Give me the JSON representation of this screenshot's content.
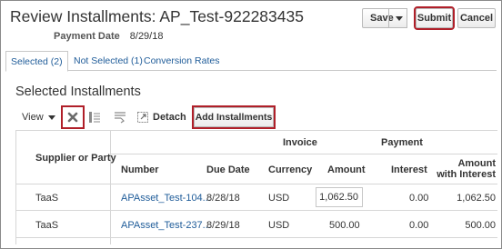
{
  "page": {
    "title": "Review Installments: AP_Test-922283435",
    "payment_date_label": "Payment Date",
    "payment_date_value": "8/29/18"
  },
  "header_buttons": {
    "save": "Save",
    "submit": "Submit",
    "cancel": "Cancel"
  },
  "tabs": [
    {
      "label": "Selected (2)",
      "active": true
    },
    {
      "label": "Not Selected (1)",
      "active": false
    },
    {
      "label": "Conversion Rates",
      "active": false
    }
  ],
  "section_title": "Selected Installments",
  "toolbar": {
    "view_label": "View",
    "detach_label": "Detach",
    "add_installments_label": "Add Installments"
  },
  "table": {
    "group_headers": {
      "invoice": "Invoice",
      "payment": "Payment"
    },
    "columns": {
      "supplier": "Supplier or Party",
      "number": "Number",
      "due_date": "Due Date",
      "currency": "Currency",
      "amount": "Amount",
      "interest": "Interest",
      "amount_with_interest_1": "Amount",
      "amount_with_interest_2": "with Interest"
    },
    "rows": [
      {
        "supplier": "TaaS",
        "number": "APAsset_Test-104...",
        "due_date": "8/28/18",
        "currency": "USD",
        "amount": "1,062.50",
        "interest": "0.00",
        "amount_with_interest": "1,062.50"
      },
      {
        "supplier": "TaaS",
        "number": "APAsset_Test-237...",
        "due_date": "8/29/18",
        "currency": "USD",
        "amount": "500.00",
        "interest": "0.00",
        "amount_with_interest": "500.00"
      }
    ]
  },
  "colors": {
    "link": "#1f5c99",
    "highlight": "#b01f29"
  }
}
